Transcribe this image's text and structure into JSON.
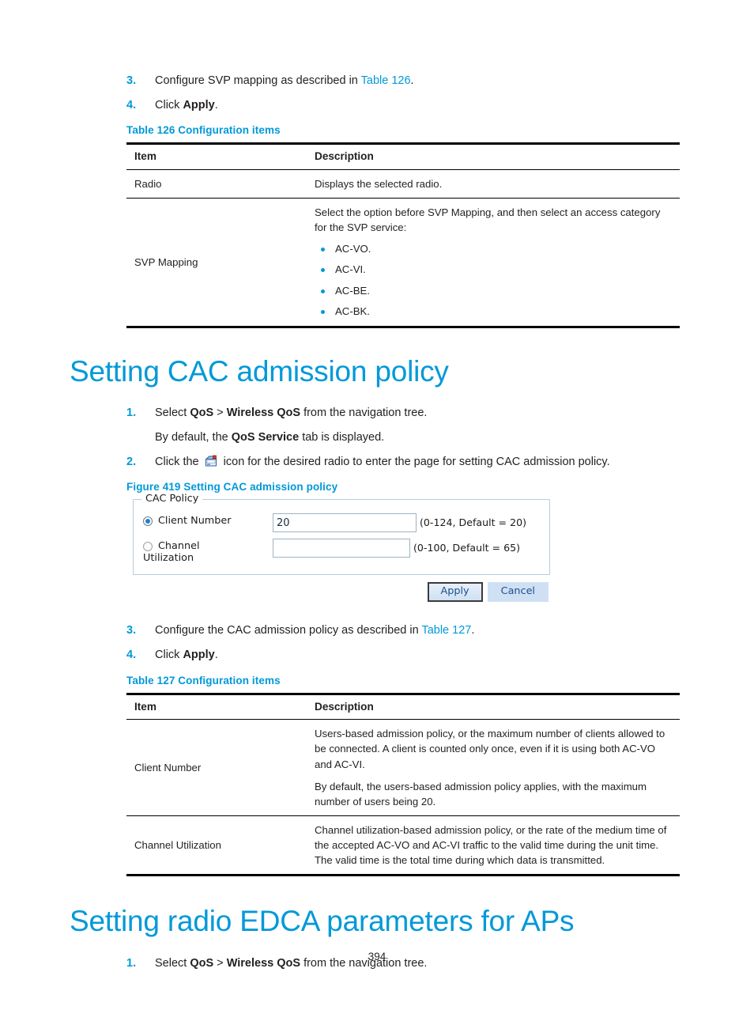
{
  "document": {
    "page_number": "394"
  },
  "section_svp": {
    "steps": [
      {
        "num": "3.",
        "text_before": "Configure SVP mapping as described in ",
        "link": "Table 126",
        "text_after": "."
      },
      {
        "num": "4.",
        "text_before": "Click ",
        "bold": "Apply",
        "text_after": "."
      }
    ],
    "table_caption": "Table 126 Configuration items",
    "table": {
      "headers": [
        "Item",
        "Description"
      ],
      "rows": [
        {
          "item": "Radio",
          "description": [
            "Displays the selected radio."
          ],
          "bullets": []
        },
        {
          "item": "SVP Mapping",
          "description": [
            "Select the option before SVP Mapping, and then select an access category for the SVP service:"
          ],
          "bullets": [
            "AC-VO.",
            "AC-VI.",
            "AC-BE.",
            "AC-BK."
          ]
        }
      ]
    }
  },
  "section_cac": {
    "heading": "Setting CAC admission policy",
    "step1": {
      "num": "1.",
      "a": "Select ",
      "b1": "QoS",
      "mid": " > ",
      "b2": "Wireless QoS",
      "c": " from the navigation tree."
    },
    "substep1": {
      "a": "By default, the ",
      "b": "QoS Service",
      "c": " tab is displayed."
    },
    "step2": {
      "num": "2.",
      "a": "Click the ",
      "icon": "radio-device-icon",
      "b": " icon for the desired radio to enter the page for setting CAC admission policy."
    },
    "figure_caption": "Figure 419 Setting CAC admission policy",
    "figure": {
      "legend": "CAC Policy",
      "client_number": {
        "label": "Client Number",
        "selected": true,
        "value": "20",
        "hint": "(0-124, Default = 20)"
      },
      "channel_utilization": {
        "label_line1": "Channel",
        "label_line2": "Utilization",
        "selected": false,
        "value": "",
        "hint": "(0-100, Default = 65)"
      },
      "apply_label": "Apply",
      "cancel_label": "Cancel"
    },
    "steps_after": [
      {
        "num": "3.",
        "text_before": "Configure the CAC admission policy as described in ",
        "link": "Table 127",
        "text_after": "."
      },
      {
        "num": "4.",
        "text_before": "Click ",
        "bold": "Apply",
        "text_after": "."
      }
    ],
    "table_caption": "Table 127 Configuration items",
    "table": {
      "headers": [
        "Item",
        "Description"
      ],
      "rows": [
        {
          "item": "Client Number",
          "description": [
            "Users-based admission policy, or the maximum number of clients allowed to be connected. A client is counted only once, even if it is using both AC-VO and AC-VI.",
            "By default, the users-based admission policy applies, with the maximum number of users being 20."
          ]
        },
        {
          "item": "Channel Utilization",
          "description": [
            "Channel utilization-based admission policy, or the rate of the medium time of the accepted AC-VO and AC-VI traffic to the valid time during the unit time. The valid time is the total time during which data is transmitted."
          ]
        }
      ]
    }
  },
  "section_edca": {
    "heading": "Setting radio EDCA parameters for APs",
    "step1": {
      "num": "1.",
      "a": "Select ",
      "b1": "QoS",
      "mid": " > ",
      "b2": "Wireless QoS",
      "c": " from the navigation tree."
    }
  },
  "colors": {
    "accent_blue": "#0099d8",
    "text": "#231f20"
  }
}
